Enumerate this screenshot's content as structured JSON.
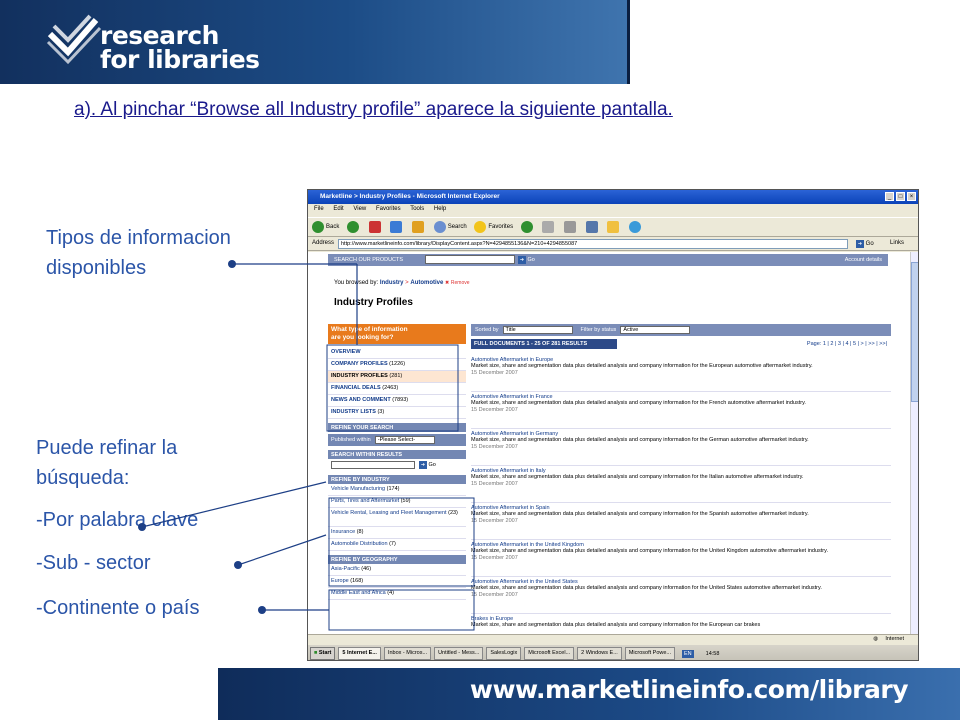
{
  "slide": {
    "logo_text_1": "research",
    "logo_text_2": "for libraries",
    "heading": "a). Al pinchar “Browse all Industry profile” aparece la siguiente pantalla.",
    "caption_info_1": "Tipos de informacion",
    "caption_info_2": "disponibles",
    "caption_refine_1": "Puede refinar la",
    "caption_refine_2": "búsqueda:",
    "caption_keyword": "-Por palabra clave",
    "caption_subsector": "-Sub - sector",
    "caption_continent": "-Continente o país",
    "footer_url": "www.marketlineinfo.com/library"
  },
  "browser": {
    "title": "Marketline > Industry Profiles - Microsoft Internet Explorer",
    "menu": [
      "File",
      "Edit",
      "View",
      "Favorites",
      "Tools",
      "Help"
    ],
    "toolbar": {
      "back": "Back",
      "search": "Search",
      "favorites": "Favorites"
    },
    "address_label": "Address",
    "address_value": "http://www.marketlineinfo.com/library/DisplayContent.aspx?N=4294855136&N=210+4294855087",
    "go_label": "Go",
    "links_label": "Links",
    "status_text": "Internet"
  },
  "page": {
    "search_label": "SEARCH OUR PRODUCTS",
    "search_go": "Go",
    "account_details": "Account details",
    "browsed_by_label": "You browsed by:",
    "crumb_industry": "Industry",
    "crumb_sep": ">",
    "crumb_automotive": "Automotive",
    "crumb_remove": "Remove",
    "page_title": "Industry Profiles",
    "type_head_1": "What type of information",
    "type_head_2": "are you looking for?",
    "types": [
      {
        "label": "OVERVIEW",
        "count": ""
      },
      {
        "label": "COMPANY PROFILES",
        "count": "(1226)"
      },
      {
        "label": "INDUSTRY PROFILES",
        "count": "(281)"
      },
      {
        "label": "FINANCIAL DEALS",
        "count": "(2463)"
      },
      {
        "label": "NEWS AND COMMENT",
        "count": "(7893)"
      },
      {
        "label": "INDUSTRY LISTS",
        "count": "(3)"
      }
    ],
    "refine_head": "REFINE YOUR SEARCH",
    "published_label": "Published within",
    "published_value": "-Please Select-",
    "within_head": "SEARCH WITHIN RESULTS",
    "within_go": "Go",
    "industry_head": "REFINE BY INDUSTRY",
    "industries": [
      {
        "label": "Vehicle Manufacturing",
        "count": "(174)"
      },
      {
        "label": "Parts, Tires and Aftermarket",
        "count": "(59)"
      },
      {
        "label": "Vehicle Rental, Leasing and Fleet Management",
        "count": "(23)"
      },
      {
        "label": "Insurance",
        "count": "(8)"
      },
      {
        "label": "Automobile Distribution",
        "count": "(7)"
      }
    ],
    "geo_head": "REFINE BY GEOGRAPHY",
    "geographies": [
      {
        "label": "Asia-Pacific",
        "count": "(46)"
      },
      {
        "label": "Europe",
        "count": "(168)"
      },
      {
        "label": "Middle East and Africa",
        "count": "(4)"
      }
    ],
    "sorted_by_label": "Sorted by",
    "sorted_by_value": "Title",
    "filter_label": "Filter by status",
    "filter_value": "Active",
    "full_docs": "FULL DOCUMENTS 1 - 25 OF 281 RESULTS",
    "pager": "Page: 1 | 2 | 3 | 4 | 5 | > | >> | >>|",
    "results": [
      {
        "title": "Automotive Aftermarket in Europe",
        "desc": "Market size, share and segmentation data plus detailed analysis and company information for the European automotive aftermarket industry.",
        "date": "15 December 2007"
      },
      {
        "title": "Automotive Aftermarket in France",
        "desc": "Market size, share and segmentation data plus detailed analysis and company information for the French automotive aftermarket industry.",
        "date": "15 December 2007"
      },
      {
        "title": "Automotive Aftermarket in Germany",
        "desc": "Market size, share and segmentation data plus detailed analysis and company information for the German automotive aftermarket industry.",
        "date": "15 December 2007"
      },
      {
        "title": "Automotive Aftermarket in Italy",
        "desc": "Market size, share and segmentation data plus detailed analysis and company information for the Italian automotive aftermarket industry.",
        "date": "15 December 2007"
      },
      {
        "title": "Automotive Aftermarket in Spain",
        "desc": "Market size, share and segmentation data plus detailed analysis and company information for the Spanish automotive aftermarket industry.",
        "date": "15 December 2007"
      },
      {
        "title": "Automotive Aftermarket in the United Kingdom",
        "desc": "Market size, share and segmentation data plus detailed analysis and company information for the United Kingdom automotive aftermarket industry.",
        "date": "15 December 2007"
      },
      {
        "title": "Automotive Aftermarket in the United States",
        "desc": "Market size, share and segmentation data plus detailed analysis and company information for the United States automotive aftermarket industry.",
        "date": "15 December 2007"
      },
      {
        "title": "Brakes in Europe",
        "desc": "Market size, share and segmentation data plus detailed analysis and company information for the European car brakes",
        "date": ""
      }
    ]
  },
  "taskbar": {
    "start": "Start",
    "items": [
      "5 Internet E...",
      "Inbox - Micros...",
      "Untitled - Mess...",
      "SalesLogix",
      "Microsoft Excel...",
      "2 Windows E...",
      "Microsoft Powe..."
    ],
    "lang": "EN",
    "clock": "14:58"
  }
}
